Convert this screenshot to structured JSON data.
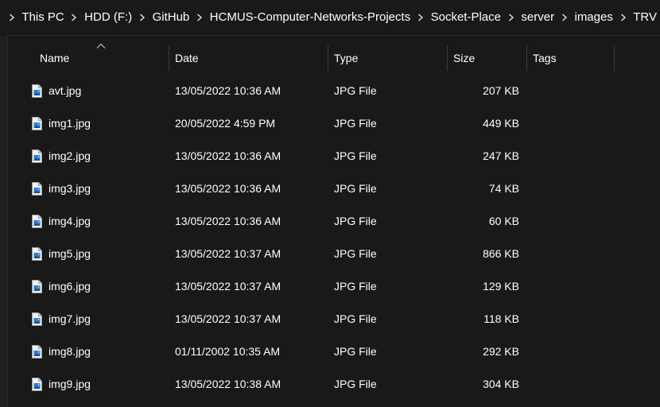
{
  "breadcrumb": {
    "items": [
      "This PC",
      "HDD (F:)",
      "GitHub",
      "HCMUS-Computer-Networks-Projects",
      "Socket-Place",
      "server",
      "images",
      "TRV"
    ]
  },
  "columns": {
    "name": "Name",
    "date": "Date",
    "type": "Type",
    "size": "Size",
    "tags": "Tags",
    "sorted_by": "Name"
  },
  "files": [
    {
      "name": "avt.jpg",
      "date": "13/05/2022 10:36 AM",
      "type": "JPG File",
      "size": "207 KB",
      "tags": "",
      "icon": "jpg-file-icon"
    },
    {
      "name": "img1.jpg",
      "date": "20/05/2022 4:59 PM",
      "type": "JPG File",
      "size": "449 KB",
      "tags": "",
      "icon": "jpg-file-icon"
    },
    {
      "name": "img2.jpg",
      "date": "13/05/2022 10:36 AM",
      "type": "JPG File",
      "size": "247 KB",
      "tags": "",
      "icon": "jpg-file-icon"
    },
    {
      "name": "img3.jpg",
      "date": "13/05/2022 10:36 AM",
      "type": "JPG File",
      "size": "74 KB",
      "tags": "",
      "icon": "jpg-file-icon"
    },
    {
      "name": "img4.jpg",
      "date": "13/05/2022 10:36 AM",
      "type": "JPG File",
      "size": "60 KB",
      "tags": "",
      "icon": "jpg-file-icon"
    },
    {
      "name": "img5.jpg",
      "date": "13/05/2022 10:37 AM",
      "type": "JPG File",
      "size": "866 KB",
      "tags": "",
      "icon": "jpg-file-icon"
    },
    {
      "name": "img6.jpg",
      "date": "13/05/2022 10:37 AM",
      "type": "JPG File",
      "size": "129 KB",
      "tags": "",
      "icon": "jpg-file-icon"
    },
    {
      "name": "img7.jpg",
      "date": "13/05/2022 10:37 AM",
      "type": "JPG File",
      "size": "118 KB",
      "tags": "",
      "icon": "jpg-file-icon"
    },
    {
      "name": "img8.jpg",
      "date": "01/11/2002 10:35 AM",
      "type": "JPG File",
      "size": "292 KB",
      "tags": "",
      "icon": "jpg-file-icon"
    },
    {
      "name": "img9.jpg",
      "date": "13/05/2022 10:38 AM",
      "type": "JPG File",
      "size": "304 KB",
      "tags": "",
      "icon": "jpg-file-icon"
    }
  ],
  "colors": {
    "background": "#191919",
    "text": "#ffffff",
    "divider": "#3c3c3c",
    "icon_accent": "#2f7fd1"
  }
}
